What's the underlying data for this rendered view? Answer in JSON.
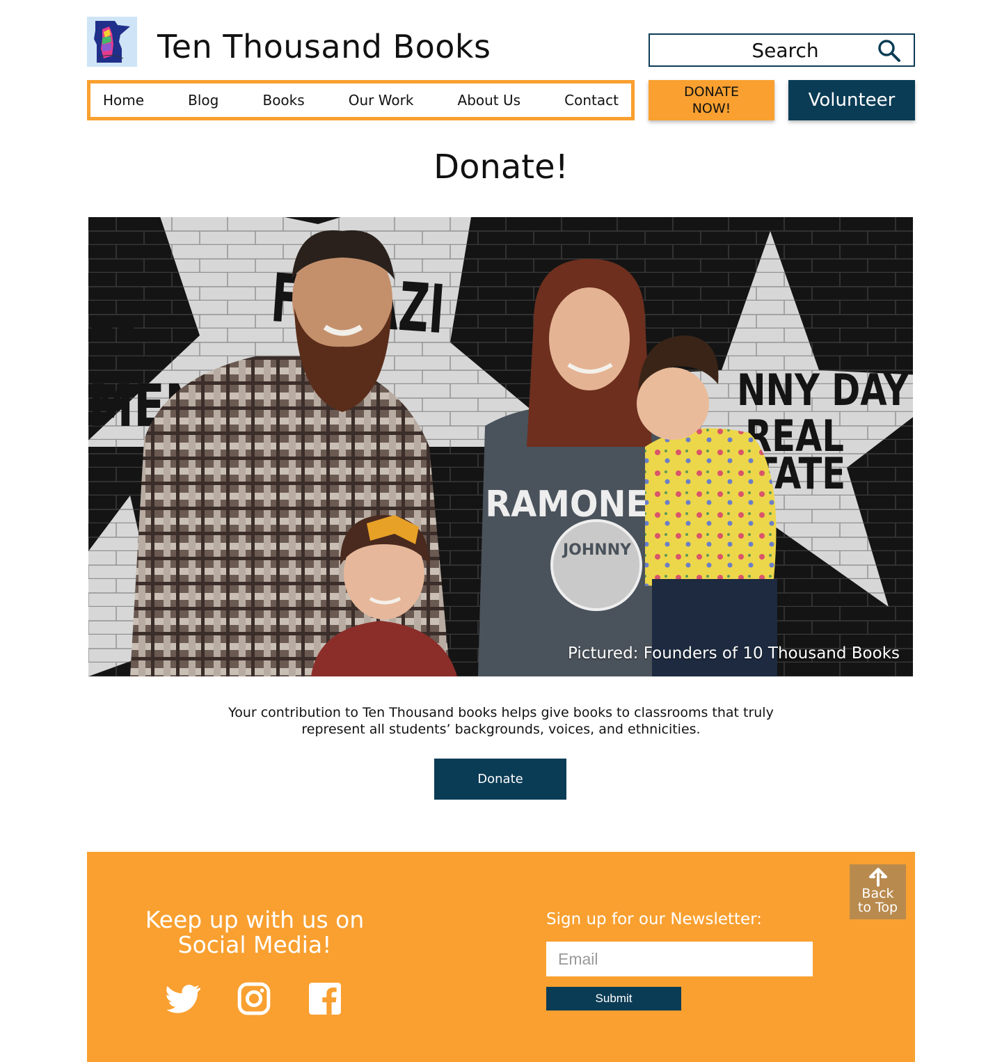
{
  "header": {
    "site_title": "Ten Thousand Books",
    "search_placeholder": "Search",
    "nav": [
      "Home",
      "Blog",
      "Books",
      "Our Work",
      "About Us",
      "Contact"
    ],
    "donate_now_label": "DONATE NOW!",
    "volunteer_label": "Volunteer"
  },
  "main": {
    "title": "Donate!",
    "hero_caption": "Pictured: Founders of 10 Thousand Books",
    "blurb_line1": "Your contribution to Ten Thousand books helps give books to classrooms that truly",
    "blurb_line2": "represent all students’ backgrounds, voices, and ethnicities.",
    "donate_button": "Donate",
    "photo_wall_text": [
      "HE",
      "MENT",
      "FUGAZI",
      "NNY DAY",
      "REAL",
      "TATE",
      "RAMONE",
      "JOHNNY"
    ]
  },
  "footer": {
    "social_heading_line1": "Keep up with us on",
    "social_heading_line2": "Social Media!",
    "social_icons": [
      "twitter-icon",
      "instagram-icon",
      "facebook-icon"
    ],
    "newsletter_heading": "Sign up for our Newsletter:",
    "email_placeholder": "Email",
    "submit_label": "Submit",
    "back_to_top_line1": "Back",
    "back_to_top_line2": "to Top"
  },
  "colors": {
    "brand_orange": "#f9a030",
    "brand_navy": "#0b3c55",
    "back_to_top": "#b98a4e"
  }
}
